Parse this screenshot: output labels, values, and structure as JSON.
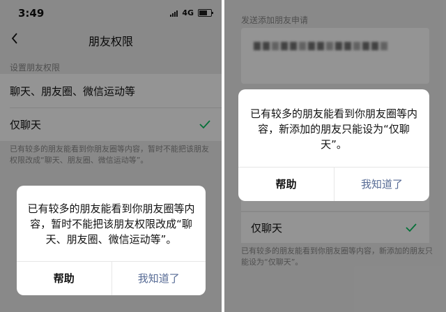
{
  "left": {
    "status": {
      "time": "3:49",
      "network": "4G"
    },
    "nav": {
      "title": "朋友权限"
    },
    "section_label": "设置朋友权限",
    "options": [
      {
        "label": "聊天、朋友圈、微信运动等"
      },
      {
        "label": "仅聊天",
        "selected": true
      }
    ],
    "note": "已有较多的朋友能看到你朋友圈等内容，暂时不能把该朋友权限改成“聊天、朋友圈、微信运动等”。",
    "dialog": {
      "message": "已有较多的朋友能看到你朋友圈等内容，暂时不能把该朋友权限改成“聊天、朋友圈、微信运动等”。",
      "help_label": "帮助",
      "ok_label": "我知道了"
    }
  },
  "right": {
    "send_request_label": "发送添加朋友申请",
    "option_chat": "仅聊天",
    "note": "已有较多的朋友能看到你朋友圈等内容，新添加的朋友只能设为“仅聊天”。",
    "dialog": {
      "message": "已有较多的朋友能看到你朋友圈等内容，新添加的朋友只能设为“仅聊天”。",
      "help_label": "帮助",
      "ok_label": "我知道了"
    }
  },
  "colors": {
    "accent_green": "#07c160",
    "link_blue": "#576b95"
  }
}
